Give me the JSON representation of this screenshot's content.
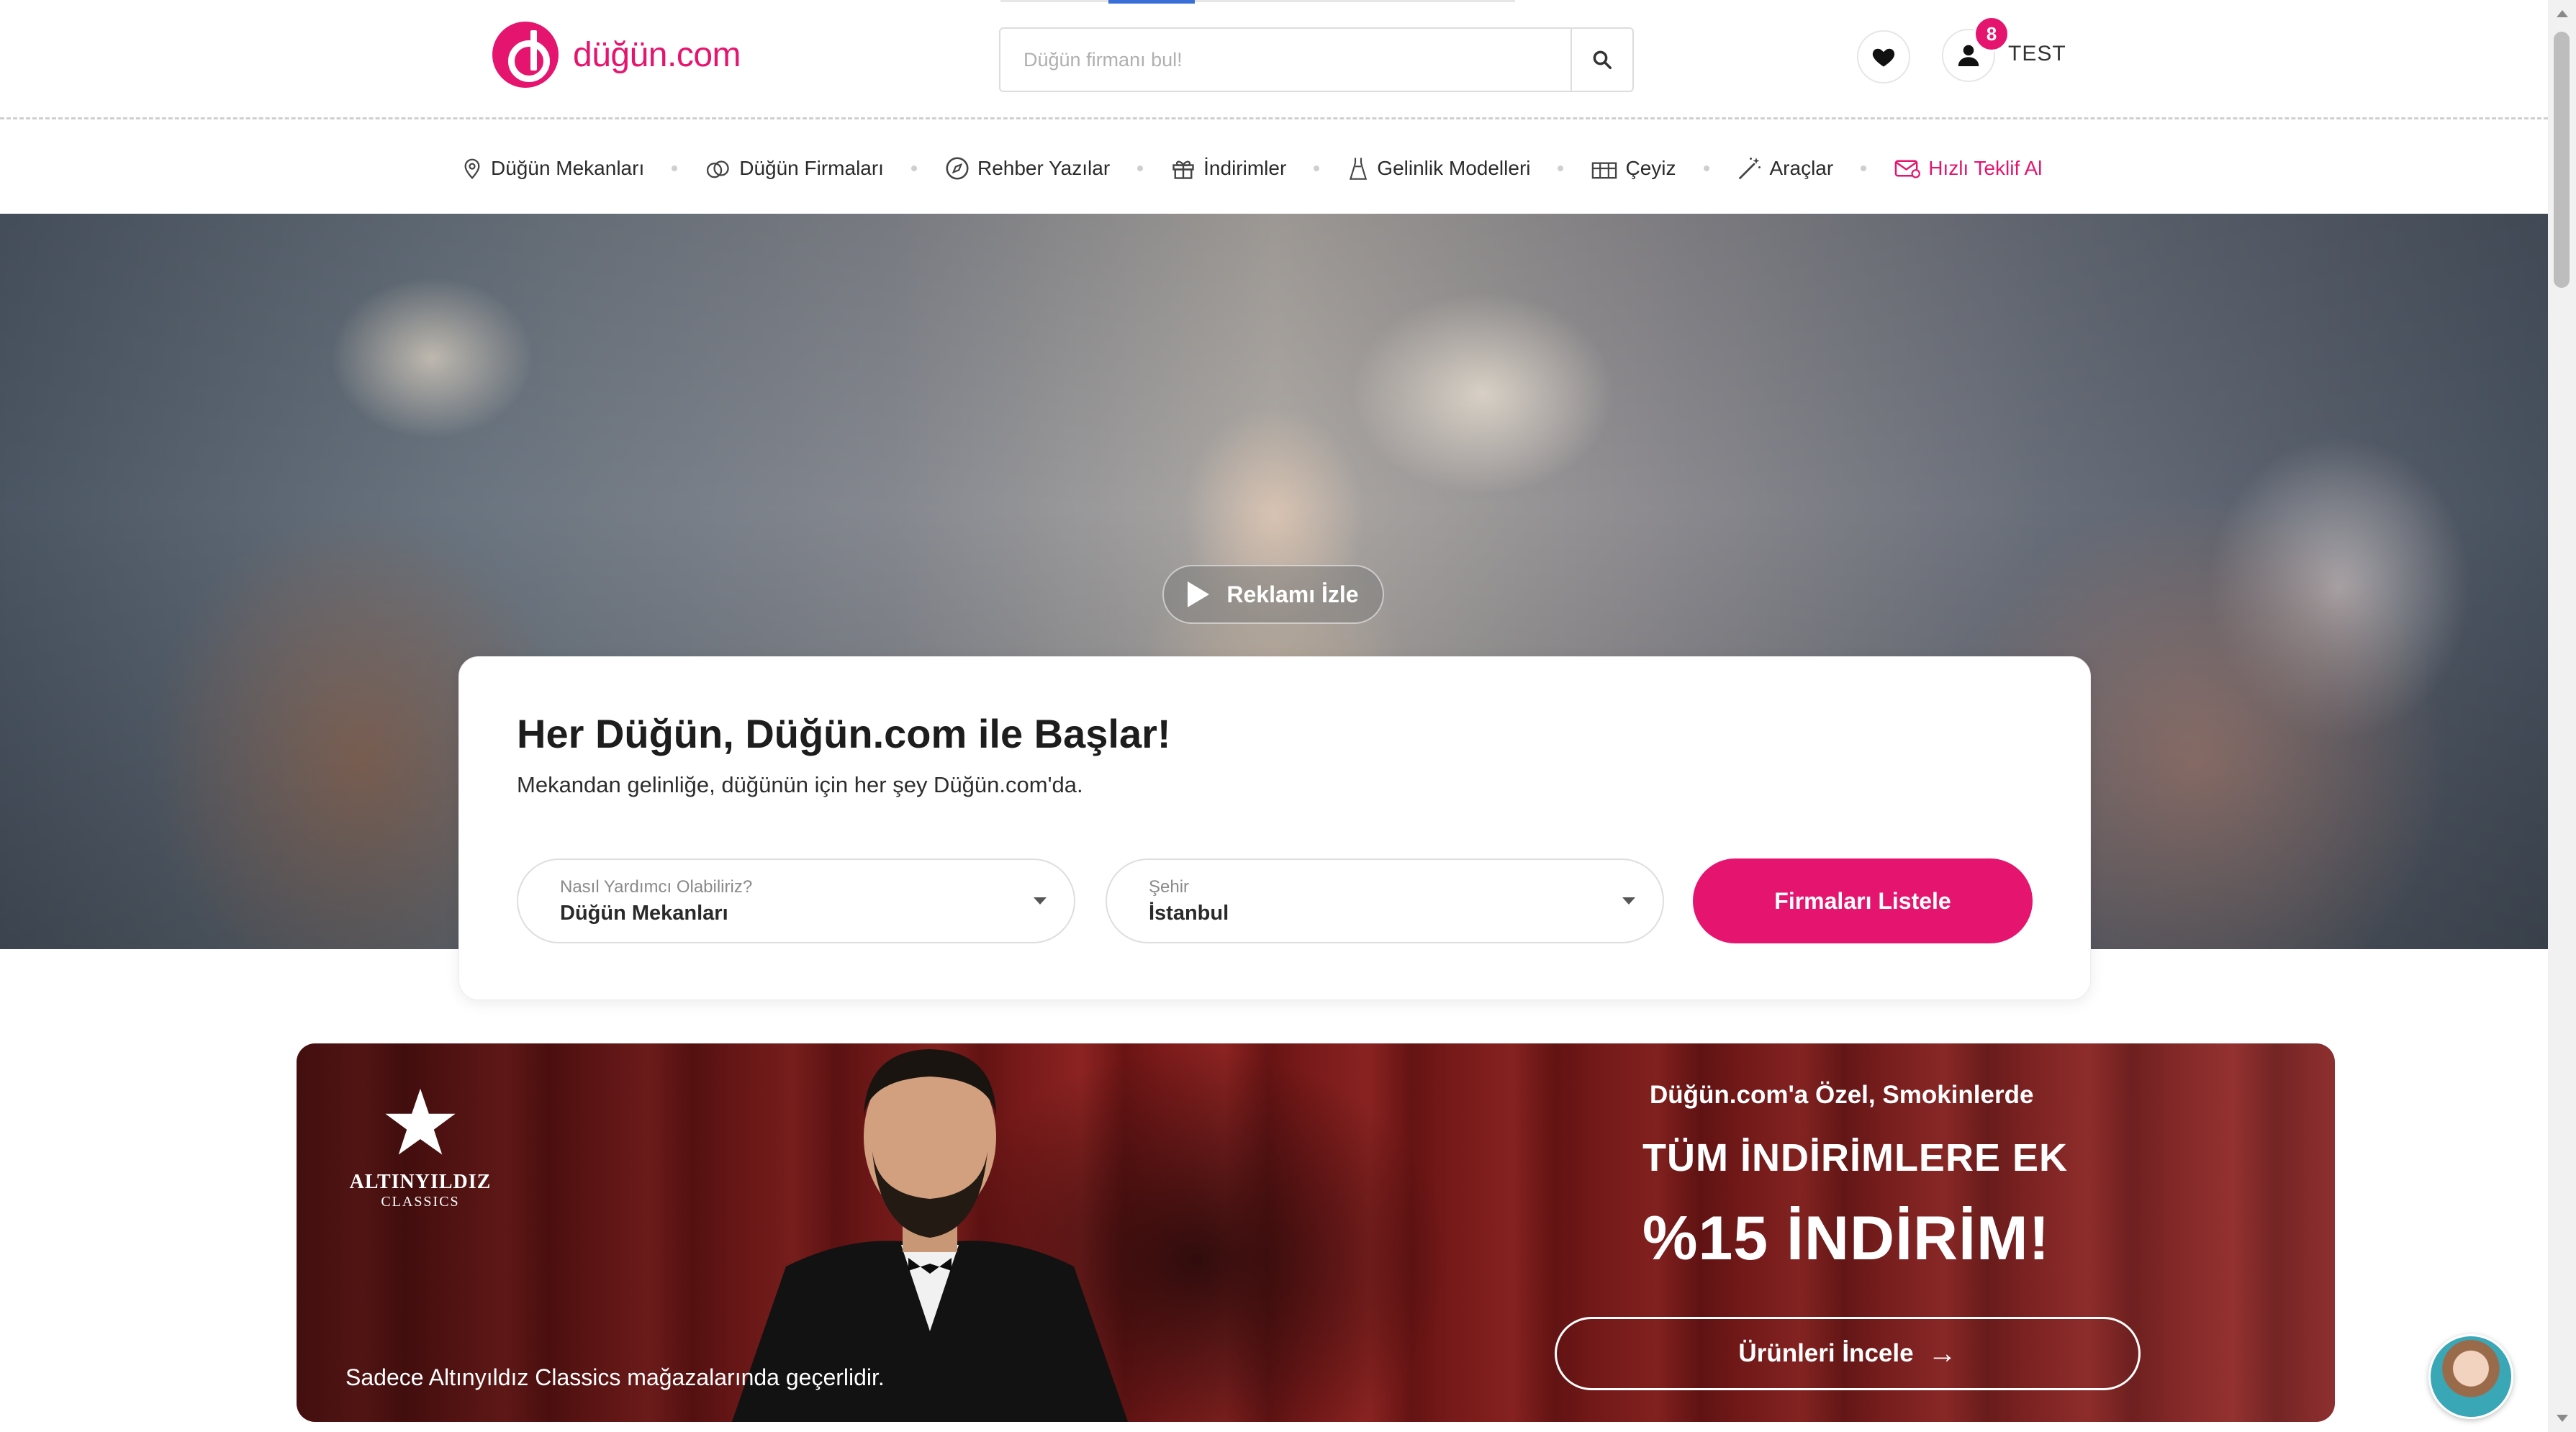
{
  "header": {
    "logo_text": "düğün.com",
    "search_placeholder": "Düğün firmanı bul!",
    "notification_count": "8",
    "user_name": "TEST"
  },
  "nav": {
    "items": [
      {
        "label": "Düğün Mekanları",
        "icon": "map-pin-icon"
      },
      {
        "label": "Düğün Firmaları",
        "icon": "rings-icon"
      },
      {
        "label": "Rehber Yazılar",
        "icon": "compass-icon"
      },
      {
        "label": "İndirimler",
        "icon": "gift-icon"
      },
      {
        "label": "Gelinlik Modelleri",
        "icon": "dress-icon"
      },
      {
        "label": "Çeyiz",
        "icon": "gift-box-icon"
      },
      {
        "label": "Araçlar",
        "icon": "magic-wand-icon"
      },
      {
        "label": "Hızlı Teklif Al",
        "icon": "mail-icon"
      }
    ]
  },
  "hero": {
    "video_button_label": "Reklamı İzle"
  },
  "search_card": {
    "title": "Her Düğün, Düğün.com ile Başlar!",
    "subtitle": "Mekandan gelinliğe, düğünün için her şey Düğün.com'da.",
    "category": {
      "label": "Nasıl Yardımcı Olabiliriz?",
      "value": "Düğün Mekanları"
    },
    "city": {
      "label": "Şehir",
      "value": "İstanbul"
    },
    "submit_label": "Firmaları Listele"
  },
  "promo": {
    "brand": "ALTINYILDIZ",
    "brand_sub": "CLASSICS",
    "kicker": "Düğün.com'a Özel, Smokinlerde",
    "line1": "TÜM İNDİRİMLERE EK",
    "line2": "%15 İNDİRİM!",
    "button_label": "Ürünleri İncele",
    "note": "Sadece Altınyıldız Classics mağazalarında geçerlidir."
  },
  "colors": {
    "brand": "#e5156f"
  }
}
